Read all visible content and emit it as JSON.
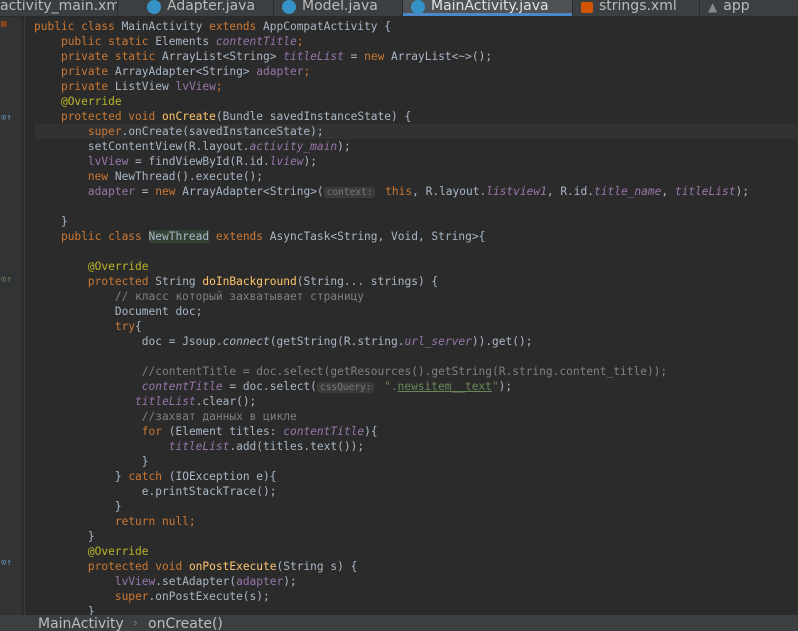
{
  "tabs": [
    {
      "label": "activity_main.xml",
      "icon": "xml-file-icon",
      "active": false
    },
    {
      "label": "Adapter.java",
      "icon": "class-icon",
      "active": false
    },
    {
      "label": "Model.java",
      "icon": "class-icon",
      "active": false
    },
    {
      "label": "MainActivity.java",
      "icon": "class-icon",
      "active": true
    },
    {
      "label": "strings.xml",
      "icon": "xml-file-icon",
      "active": false
    },
    {
      "label": "app",
      "icon": "gradle-app-icon",
      "active": false
    }
  ],
  "code": {
    "l1_kw": "public class ",
    "l1_name": "MainActivity ",
    "l1_kw2": "extends ",
    "l1_sup": "AppCompatActivity {",
    "l2_kw": "public static ",
    "l2_type": "Elements ",
    "l2_f": "contentTitle",
    "l2_end": ";",
    "l3_kw": "private static ",
    "l3_type": "ArrayList<String> ",
    "l3_f": "titleList",
    "l3_eq": " = ",
    "l3_new": "new ",
    "l3_rest": "ArrayList<~>();",
    "l4_kw": "private ",
    "l4_type": "ArrayAdapter<String> ",
    "l4_f": "adapter",
    "l4_end": ";",
    "l5_kw": "private ",
    "l5_type": "ListView ",
    "l5_f": "lvView",
    "l5_end": ";",
    "l6_ann": "@Override",
    "l7_kw": "protected void ",
    "l7_m": "onCreate",
    "l7_rest": "(Bundle savedInstanceState) {",
    "l8_kw": "super",
    "l8_rest": ".onCreate(savedInstanceState);",
    "l9_a": "setContentView(R.layout.",
    "l9_f": "activity_main",
    "l9_b": ");",
    "l10_f": "lvView",
    "l10_a": " = findViewById(R.id.",
    "l10_f2": "lview",
    "l10_b": ");",
    "l11_kw": "new ",
    "l11_rest": "NewThread().execute();",
    "l12_f": "adapter",
    "l12_a": " = ",
    "l12_kw": "new ",
    "l12_b": "ArrayAdapter<String>(",
    "l12_hint": "context:",
    "l12_kw2": " this",
    "l12_c": ", R.layout.",
    "l12_f2": "listview1",
    "l12_d": ", R.id.",
    "l12_f3": "title_name",
    "l12_e": ", ",
    "l12_f4": "titleList",
    "l12_g": ");",
    "l14": "}",
    "l15_kw": "public class ",
    "l15_name": "NewThread",
    "l15_kw2": " extends ",
    "l15_rest": "AsyncTask<String, Void, String>{",
    "l17_ann": "@Override",
    "l18_kw": "protected ",
    "l18_a": "String ",
    "l18_m": "doInBackground",
    "l18_rest": "(String... strings) {",
    "l19_c": "// класс который захватывает страницу",
    "l20": "Document doc;",
    "l21_kw": "try",
    "l21_b": "{",
    "l22_a": "doc = Jsoup.",
    "l22_m": "connect",
    "l22_b": "(getString(R.string.",
    "l22_f": "url_server",
    "l22_c": ")).get();",
    "l24_c": "//contentTitle = doc.select(getResources().getString(R.string.content_title));",
    "l25_f": "contentTitle",
    "l25_a": " = doc.select(",
    "l25_hint": "cssQuery:",
    "l25_s1": " \".",
    "l25_s2": "newsitem__text",
    "l25_s3": "\"",
    "l25_b": ");",
    "l26_f": "titleList",
    "l26_a": ".clear();",
    "l27_c": "//захват данных в цикле",
    "l28_kw": "for ",
    "l28_a": "(Element titles: ",
    "l28_f": "contentTitle",
    "l28_b": "){",
    "l29_f": "titleList",
    "l29_a": ".add(titles.text());",
    "l30": "}",
    "l31_a": "} ",
    "l31_kw": "catch ",
    "l31_b": "(IOException e){",
    "l32": "e.printStackTrace();",
    "l33": "}",
    "l34_kw": "return null",
    "l34_b": ";",
    "l35": "}",
    "l36_ann": "@Override",
    "l37_kw": "protected void ",
    "l37_m": "onPostExecute",
    "l37_rest": "(String s) {",
    "l38_f": "lvView",
    "l38_a": ".setAdapter(",
    "l38_f2": "adapter",
    "l38_b": ");",
    "l39_kw": "super",
    "l39_rest": ".onPostExecute(s);",
    "l40": "}"
  },
  "breadcrumb": {
    "class": "MainActivity",
    "separator": "›",
    "method": "onCreate()"
  },
  "gutter_icons": [
    "xml-file-icon",
    "override-icon",
    "override-icon",
    "override-icon"
  ],
  "colors": {
    "keyword": "#cc7832",
    "field": "#9876aa",
    "method": "#ffc66d",
    "annotation": "#bbb529",
    "string": "#6a8759",
    "comment": "#808080",
    "text": "#a9b7c6",
    "background": "#2b2b2b"
  }
}
